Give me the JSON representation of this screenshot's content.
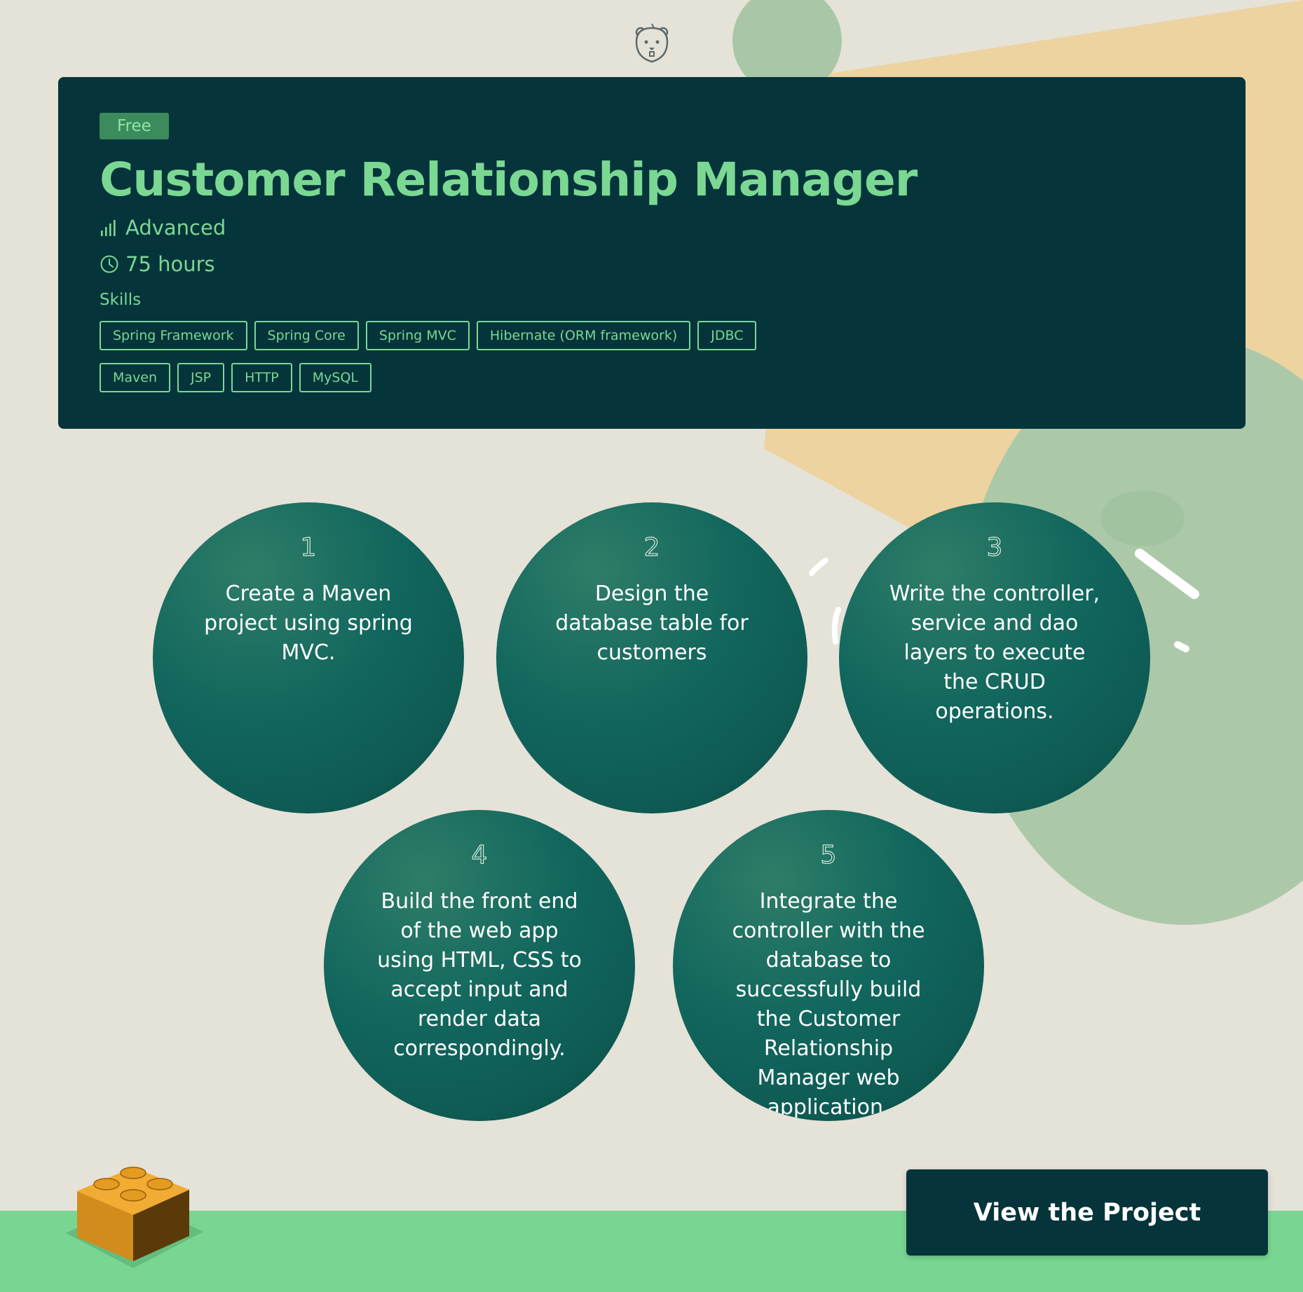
{
  "header": {
    "logo_icon": "bear-face-icon"
  },
  "project": {
    "badge": "Free",
    "title": "Customer Relationship Manager",
    "level": "Advanced",
    "level_icon": "signal-bars-icon",
    "duration": "75 hours",
    "duration_icon": "clock-icon",
    "skills_label": "Skills",
    "skills": [
      "Spring Framework",
      "Spring Core",
      "Spring MVC",
      "Hibernate (ORM framework)",
      "JDBC",
      "Maven",
      "JSP",
      "HTTP",
      "MySQL"
    ]
  },
  "steps": [
    {
      "number": "1",
      "text": "Create a Maven project using spring MVC."
    },
    {
      "number": "2",
      "text": "Design the database table for customers"
    },
    {
      "number": "3",
      "text": "Write the controller, service and dao layers to execute the CRUD operations."
    },
    {
      "number": "4",
      "text": "Build the front end of the web app using HTML, CSS to accept input and render data correspondingly."
    },
    {
      "number": "5",
      "text": "Integrate the controller with the database to successfully build the Customer Relationship Manager web application."
    }
  ],
  "cta": {
    "label": "View the Project"
  },
  "colors": {
    "card_bg": "#05343b",
    "accent": "#7bd892",
    "step_bg": "#11665d",
    "ground": "#79d692",
    "page_bg": "#e5e2d8"
  }
}
